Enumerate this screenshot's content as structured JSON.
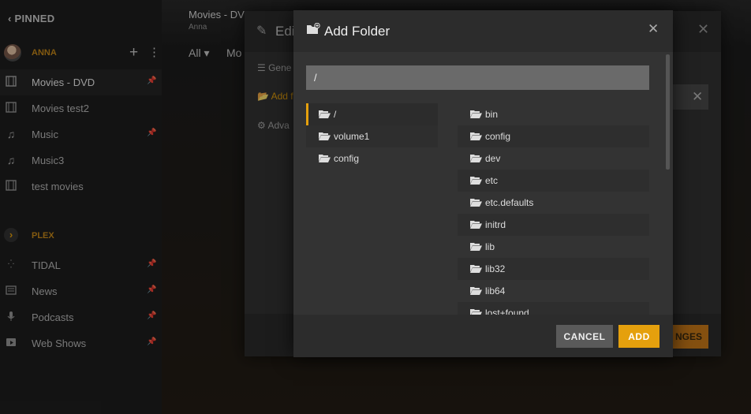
{
  "sidebar": {
    "pinned_label": "PINNED",
    "user_name": "ANNA",
    "items": [
      {
        "label": "Movies - DVD",
        "icon": "film-icon"
      },
      {
        "label": "Movies test2",
        "icon": "film-icon"
      },
      {
        "label": "Music",
        "icon": "music-icon"
      },
      {
        "label": "Music3",
        "icon": "music-icon"
      },
      {
        "label": "test movies",
        "icon": "film-icon"
      }
    ],
    "plex_label": "PLEX",
    "plex_items": [
      {
        "label": "TIDAL",
        "icon": "tidal-icon"
      },
      {
        "label": "News",
        "icon": "news-icon"
      },
      {
        "label": "Podcasts",
        "icon": "microphone-icon"
      },
      {
        "label": "Web Shows",
        "icon": "play-icon"
      }
    ]
  },
  "main": {
    "title": "Movies - DV",
    "subtitle": "Anna",
    "filter": "All",
    "filter2": "Mo"
  },
  "edit_dialog": {
    "title": "Edi",
    "nav": [
      "Gene",
      "Add f",
      "Adva"
    ],
    "save_label": "NGES"
  },
  "add_folder": {
    "title": "Add Folder",
    "path_value": "/",
    "left_folders": [
      "/",
      "volume1",
      "config"
    ],
    "right_folders": [
      "bin",
      "config",
      "dev",
      "etc",
      "etc.defaults",
      "initrd",
      "lib",
      "lib32",
      "lib64",
      "lost+found"
    ],
    "cancel_label": "CANCEL",
    "add_label": "ADD"
  },
  "colors": {
    "accent": "#e5a00d",
    "dialog_bg": "#333333",
    "header_bg": "#2c2c2c"
  }
}
